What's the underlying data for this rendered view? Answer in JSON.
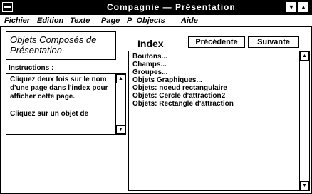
{
  "window": {
    "title": "Compagnie — Présentation",
    "system_menu_icon": "system-menu-icon",
    "minimize_icon": "minimize-arrow-icon",
    "maximize_icon": "maximize-arrow-icon",
    "title_bar_color": "#000000"
  },
  "menu": {
    "items": [
      "Fichier",
      "Edition",
      "Texte",
      "Page",
      "P_Objects",
      "Aide"
    ]
  },
  "heading": {
    "line1": "Objets Composés de",
    "line2": "Présentation"
  },
  "instructions": {
    "label": "Instructions :",
    "paragraph1": "Cliquez deux fois sur le nom d'une page dans l'index pour afficher cette page.",
    "paragraph2": "Cliquez sur un objet de"
  },
  "index": {
    "title": "Index",
    "items": [
      "Boutons...",
      "Champs...",
      "Groupes...",
      "Objets Graphiques...",
      "Objets: noeud rectangulaire",
      "Objets: Cercle d'attraction2",
      "Objets: Rectangle d'attraction"
    ]
  },
  "buttons": {
    "previous": "Précédente",
    "next": "Suivante"
  }
}
